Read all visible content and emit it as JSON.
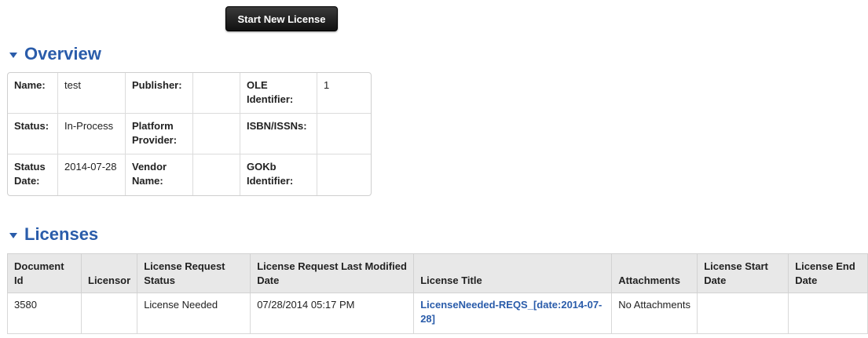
{
  "toolbar": {
    "start_new_license": "Start New License"
  },
  "overview": {
    "title": "Overview",
    "rows": [
      {
        "c1_label": "Name:",
        "c1_value": "test",
        "c2_label": "Publisher:",
        "c2_value": "",
        "c3_label": "OLE Identifier:",
        "c3_value": "1"
      },
      {
        "c1_label": "Status:",
        "c1_value": "In-Process",
        "c2_label": "Platform Provider:",
        "c2_value": "",
        "c3_label": "ISBN/ISSNs:",
        "c3_value": ""
      },
      {
        "c1_label": "Status Date:",
        "c1_value": "2014-07-28",
        "c2_label": "Vendor Name:",
        "c2_value": "",
        "c3_label": "GOKb Identifier:",
        "c3_value": ""
      }
    ]
  },
  "licenses": {
    "title": "Licenses",
    "headers": {
      "doc_id": "Document Id",
      "licensor": "Licensor",
      "req_status": "License Request Status",
      "req_modified": "License Request Last Modified Date",
      "title": "License Title",
      "attachments": "Attachments",
      "start_date": "License Start Date",
      "end_date": "License End Date"
    },
    "rows": [
      {
        "doc_id": "3580",
        "licensor": "",
        "req_status": "License Needed",
        "req_modified": "07/28/2014 05:17 PM",
        "title": "LicenseNeeded-REQS_[date:2014-07-28]",
        "attachments": "No Attachments",
        "start_date": "",
        "end_date": ""
      }
    ]
  },
  "colors": {
    "link": "#2a5caa",
    "header_bg": "#e8e8e8",
    "button_bg": "#1a1a1a"
  }
}
